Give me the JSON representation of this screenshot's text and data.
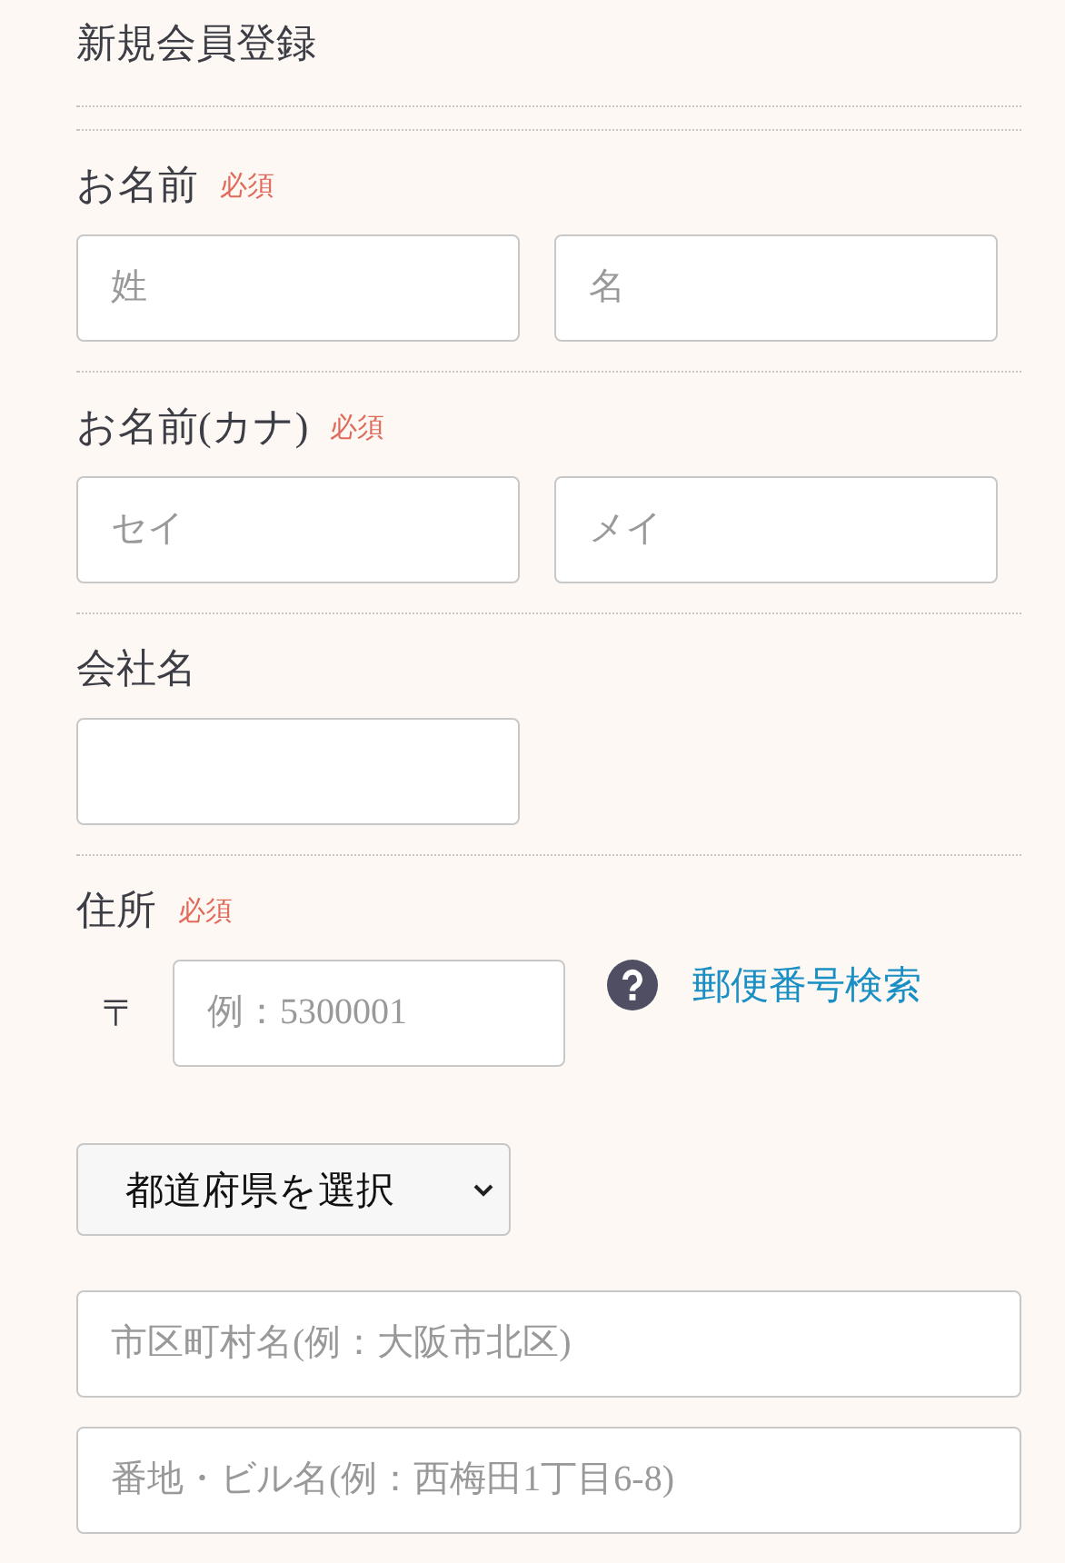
{
  "title": "新規会員登録",
  "sections": [
    {
      "label": "お名前",
      "required": "必須",
      "kind": "pair",
      "fields": [
        {
          "placeholder": "姓"
        },
        {
          "placeholder": "名"
        }
      ]
    },
    {
      "label": "お名前(カナ)",
      "required": "必須",
      "kind": "pair",
      "fields": [
        {
          "placeholder": "セイ"
        },
        {
          "placeholder": "メイ"
        }
      ]
    },
    {
      "label": "会社名",
      "kind": "single"
    },
    {
      "label": "住所",
      "required": "必須",
      "kind": "address",
      "postal": {
        "mark": "〒",
        "placeholder": "例：5300001"
      },
      "lookup": "郵便番号検索",
      "prefecture": "都道府県を選択",
      "lines": [
        {
          "placeholder": "市区町村名(例：大阪市北区)"
        },
        {
          "placeholder": "番地・ビル名(例：西梅田1丁目6-8)"
        }
      ]
    }
  ]
}
